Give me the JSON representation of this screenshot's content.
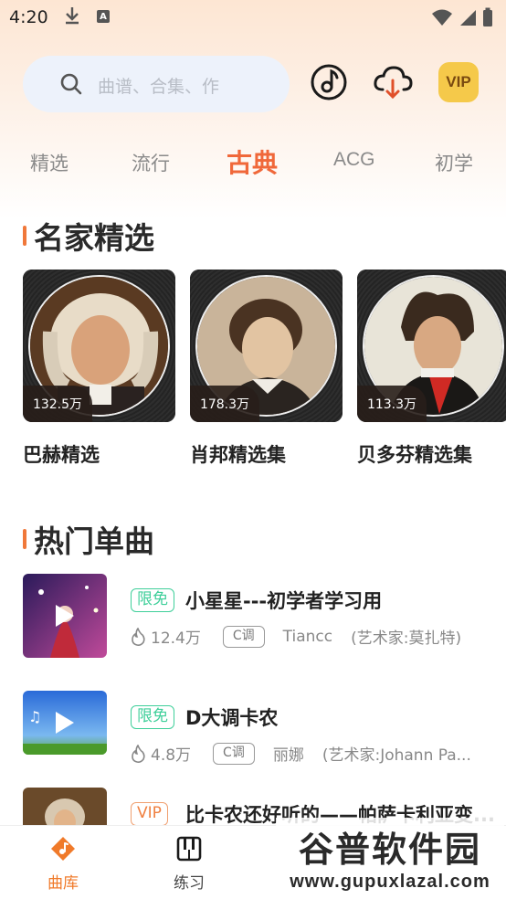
{
  "status_bar": {
    "time": "4:20",
    "download_icon": "download-icon",
    "notification_icon": "a-app-icon"
  },
  "header": {
    "search_placeholder": "曲谱、合集、作",
    "vip_label": "VIP"
  },
  "tabs": [
    {
      "label": "精选",
      "active": false
    },
    {
      "label": "流行",
      "active": false
    },
    {
      "label": "古典",
      "active": true
    },
    {
      "label": "ACG",
      "active": false
    },
    {
      "label": "初学",
      "active": false
    }
  ],
  "famous": {
    "title": "名家精选",
    "cards": [
      {
        "name": "巴赫精选",
        "count": "132.5万"
      },
      {
        "name": "肖邦精选集",
        "count": "178.3万"
      },
      {
        "name": "贝多芬精选集",
        "count": "113.3万"
      }
    ]
  },
  "hot": {
    "title": "热门单曲",
    "songs": [
      {
        "tag": "限免",
        "title": "小星星---初学者学习用",
        "plays": "12.4万",
        "key": "C调",
        "artist": "Tiancc",
        "composer": "(艺术家:莫扎特)"
      },
      {
        "tag": "限免",
        "title": "D大调卡农",
        "plays": "4.8万",
        "key": "C调",
        "artist": "丽娜",
        "composer": "(艺术家:Johann Pa..."
      },
      {
        "tag": "VIP",
        "title": "比卡农还好听的——帕萨卡利亚变..."
      }
    ]
  },
  "bottom_nav": [
    {
      "label": "曲库",
      "active": true
    },
    {
      "label": "练习",
      "active": false
    }
  ],
  "watermark": {
    "line1": "谷普软件园",
    "line2": "www.gupuxlazal.com"
  },
  "colors": {
    "accent": "#f0683a",
    "free_tag": "#3fcf9a",
    "vip_tag": "#f08040",
    "vip_badge": "#f5c94a"
  }
}
